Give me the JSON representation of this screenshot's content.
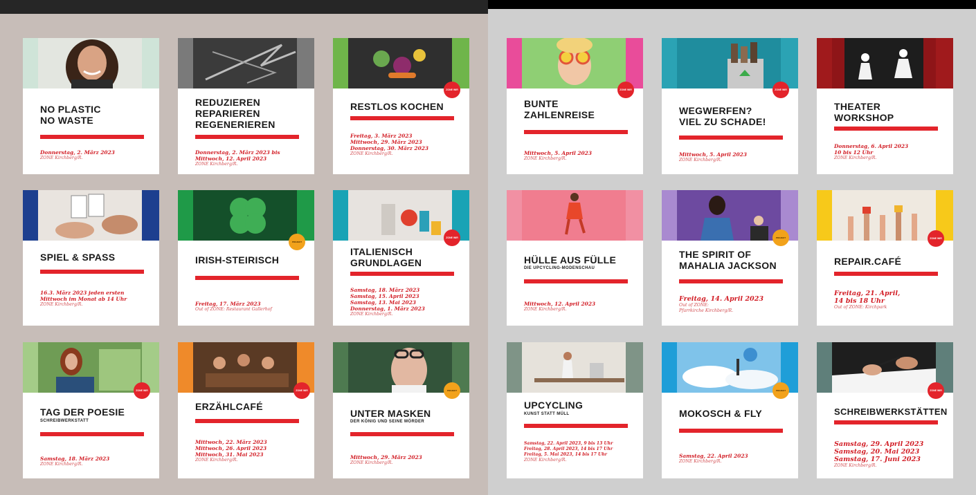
{
  "badges": {
    "red": "ZONE WIR",
    "orange": "PROJEKT"
  },
  "colors": {
    "accent_red": "#e3242b",
    "left_page_bg": "#c7bdb8",
    "right_page_bg": "#cfcfcf"
  },
  "left_page": {
    "cards": [
      {
        "title": "NO PLASTIC\nNO WASTE",
        "date": "Donnerstag, 2. März 2023",
        "location": "ZONE Kirchberg/R."
      },
      {
        "title": "REDUZIEREN\nREPARIEREN\nREGENERIEREN",
        "date": "Donnerstag, 2. März 2023 bis\nMittwoch, 12. April 2023",
        "location": "ZONE Kirchberg/R."
      },
      {
        "title": "RESTLOS KOCHEN",
        "date": "Freitag, 3. März 2023\nMittwoch, 29. März 2023\nDonnerstag, 30. März 2023",
        "location": "ZONE Kirchberg/R."
      },
      {
        "title": "SPIEL & SPASS",
        "date": "16.3. März 2023 jeden ersten\nMittwoch im Monat ab 14 Uhr",
        "location": "ZONE Kirchberg/R."
      },
      {
        "title": "IRISH-STEIRISCH",
        "date": "Freitag, 17. März 2023",
        "location": "Out of ZONE: Restaurant Gallerhof"
      },
      {
        "title": "ITALIENISCH\nGRUNDLAGEN",
        "date": "Samstag, 18. März 2023\nSamstag, 15. April 2023\nSamstag, 13. Mai 2023\nDonnerstag, 1. März 2023",
        "location": "ZONE Kirchberg/R."
      },
      {
        "title": "TAG DER POESIE",
        "subtitle": "SCHREIBWERKSTATT",
        "date": "Samstag, 18. März 2023",
        "location": "ZONE Kirchberg/R."
      },
      {
        "title": "ERZÄHLCAFÉ",
        "date": "Mittwoch, 22. März 2023\nMittwoch, 26. April 2023\nMittwoch, 31. Mai 2023",
        "location": "ZONE Kirchberg/R."
      },
      {
        "title": "UNTER MASKEN",
        "subtitle": "DER KÖNIG UND SEINE MÖRDER",
        "date": "Mittwoch, 29. März 2023",
        "location": "ZONE Kirchberg/R."
      }
    ]
  },
  "right_page": {
    "cards": [
      {
        "title": "BUNTE\nZAHLENREISE",
        "date": "Mittwoch, 5. April 2023",
        "location": "ZONE Kirchberg/R."
      },
      {
        "title": "WEGWERFEN?\nVIEL ZU SCHADE!",
        "date": "Mittwoch, 5. April 2023",
        "location": "ZONE Kirchberg/R."
      },
      {
        "title": "THEATER\nWORKSHOP",
        "date": "Donnerstag, 6. April 2023\n10 bis 12 Uhr",
        "location": "ZONE Kirchberg/R."
      },
      {
        "title": "HÜLLE AUS FÜLLE",
        "subtitle": "DIE UPCYCLING-MODENSCHAU",
        "date": "Mittwoch, 12. April 2023",
        "location": "ZONE Kirchberg/R."
      },
      {
        "title": "THE SPIRIT OF\nMAHALIA JACKSON",
        "date": "Freitag, 14. April 2023",
        "location": "Out of ZONE:\nPfarrkirche Kirchberg/R."
      },
      {
        "title": "REPAIR.CAFÉ",
        "date": "Freitag, 21. April,\n14 bis 18 Uhr",
        "location": "Out of ZONE: Kirchpark"
      },
      {
        "title": "UPCYCLING",
        "subtitle": "KUNST STATT MÜLL",
        "date": "Samstag, 22. April 2023, 9 bis 13 Uhr\nFreitag, 28. April 2023, 14 bis 17 Uhr\nFreitag, 5. Mai 2023, 14 bis 17 Uhr",
        "location": "ZONE Kirchberg/R."
      },
      {
        "title": "MOKOSCH & FLY",
        "date": "Samstag, 22. April 2023",
        "location": "ZONE Kirchberg/R."
      },
      {
        "title": "SCHREIBWERKSTÄTTEN",
        "date": "Samstag, 29. April 2023\nSamstag, 20. Mai 2023\nSamstag, 17. Juni 2023",
        "location": "ZONE Kirchberg/R."
      }
    ]
  }
}
